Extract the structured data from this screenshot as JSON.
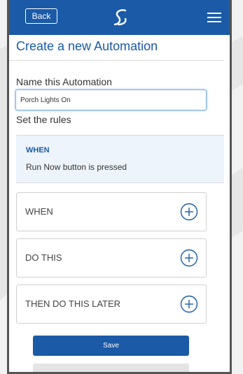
{
  "header": {
    "back_label": "Back",
    "logo_icon": "s-swoosh-logo-icon",
    "menu_icon": "hamburger-menu-icon",
    "background_color": "#1b5aa6"
  },
  "page": {
    "title": "Create a new Automation"
  },
  "name_field": {
    "label": "Name this Automation",
    "value": "Porch Lights On"
  },
  "rules": {
    "label": "Set the rules",
    "summary": {
      "heading": "WHEN",
      "text": "Run Now button is pressed"
    },
    "sections": [
      {
        "label": "WHEN",
        "icon": "add-circle-icon"
      },
      {
        "label": "DO THIS",
        "icon": "add-circle-icon"
      },
      {
        "label": "THEN DO THIS LATER",
        "icon": "add-circle-icon"
      }
    ]
  },
  "actions": {
    "save_label": "Save"
  },
  "colors": {
    "accent": "#1b5aa6",
    "summary_bg": "#eef4fb",
    "input_focus": "#7fb0e6"
  }
}
